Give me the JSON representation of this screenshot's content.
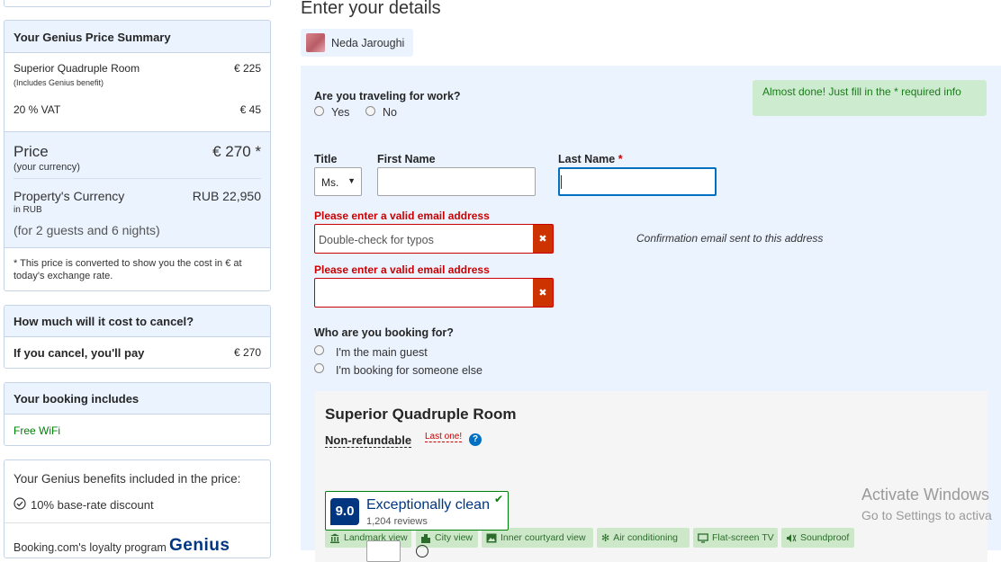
{
  "sidebar": {
    "price_summary": {
      "title": "Your Genius Price Summary",
      "room_name": "Superior Quadruple Room",
      "room_price": "€ 225",
      "room_note": "(Includes Genius benefit)",
      "vat_label": "20 % VAT",
      "vat_price": "€ 45",
      "price_label": "Price",
      "price_value": "€ 270 *",
      "price_sub": "(your currency)",
      "property_currency_label": "Property's Currency",
      "property_currency_value": "RUB 22,950",
      "property_currency_sub": "in RUB",
      "guests_nights": "(for 2 guests and 6 nights)",
      "note": "*  This price is converted to show you the cost in € at today's exchange rate."
    },
    "cancel": {
      "title": "How much will it cost to cancel?",
      "label": "If you cancel, you'll pay",
      "value": "€ 270"
    },
    "includes": {
      "title": "Your booking includes",
      "item": "Free WiFi"
    },
    "genius": {
      "title": "Your Genius benefits included in the price:",
      "benefit": "10% base-rate discount",
      "loyalty_text": "Booking.com's loyalty program",
      "logo_text": "Genius"
    }
  },
  "main": {
    "heading": "Enter your details",
    "user_name": "Neda Jaroughi",
    "almost_done": "Almost done! Just fill in the * required info",
    "work_question": "Are you traveling for work?",
    "work_yes": "Yes",
    "work_no": "No",
    "title_label": "Title",
    "title_value": "Ms.",
    "first_name_label": "First Name",
    "last_name_label": "Last Name",
    "required_star": "*",
    "email_error": "Please enter a valid email address",
    "email_placeholder": "Double-check for typos",
    "confirm_email_error": "Please enter a valid email address",
    "confirmation_note": "Confirmation email sent to this address",
    "booking_for_question": "Who are you booking for?",
    "main_guest": "I'm the main guest",
    "someone_else": "I'm booking for someone else",
    "room": {
      "name": "Superior Quadruple Room",
      "policy": "Non-refundable",
      "last_one": "Last one!",
      "facilities": [
        {
          "label": "Landmark view",
          "icon": "landmark-icon"
        },
        {
          "label": "City view",
          "icon": "city-icon"
        },
        {
          "label": "Inner courtyard view",
          "icon": "courtyard-icon"
        },
        {
          "label": "Air conditioning",
          "icon": "snowflake-icon"
        },
        {
          "label": "Flat-screen TV",
          "icon": "tv-icon"
        },
        {
          "label": "Soundproof",
          "icon": "soundproof-icon"
        }
      ],
      "score": "9.0",
      "score_label": "Exceptionally clean",
      "reviews": "1,204 reviews"
    }
  },
  "watermark": {
    "line1": "Activate Windows",
    "line2": "Go to Settings to activa"
  },
  "colors": {
    "brand_blue": "#003580",
    "link_blue": "#0071c2",
    "error_red": "#cc0000",
    "green": "#008009",
    "panel_bg": "#ebf3ff"
  }
}
